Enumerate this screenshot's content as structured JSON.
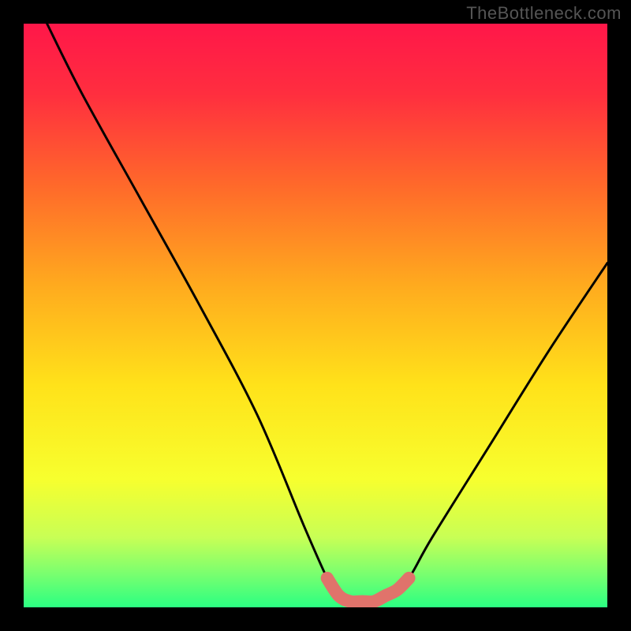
{
  "watermark": "TheBottleneck.com",
  "chart_data": {
    "type": "line",
    "title": "",
    "xlabel": "",
    "ylabel": "",
    "xlim": [
      0,
      100
    ],
    "ylim": [
      0,
      100
    ],
    "series": [
      {
        "name": "bottleneck-curve",
        "x": [
          4,
          10,
          20,
          30,
          40,
          48,
          52,
          54,
          57,
          60,
          63,
          66,
          70,
          80,
          90,
          100
        ],
        "y": [
          100,
          88,
          70,
          52,
          33,
          14,
          5,
          2,
          1,
          1,
          2,
          5,
          12,
          28,
          44,
          59
        ]
      },
      {
        "name": "flat-bottom-highlight",
        "x": [
          52,
          54,
          56,
          58,
          60,
          62,
          64,
          66
        ],
        "y": [
          5,
          2,
          1,
          1,
          1,
          2,
          3,
          5
        ]
      }
    ],
    "gradient_stops": [
      {
        "offset": 0.0,
        "color": "#ff1749"
      },
      {
        "offset": 0.12,
        "color": "#ff2e3f"
      },
      {
        "offset": 0.28,
        "color": "#ff6a2a"
      },
      {
        "offset": 0.45,
        "color": "#ffab1e"
      },
      {
        "offset": 0.62,
        "color": "#ffe21a"
      },
      {
        "offset": 0.78,
        "color": "#f7ff2e"
      },
      {
        "offset": 0.88,
        "color": "#c8ff55"
      },
      {
        "offset": 0.94,
        "color": "#7dff6e"
      },
      {
        "offset": 1.0,
        "color": "#2bff82"
      }
    ],
    "highlight_color": "#e0736b",
    "curve_color": "#000000"
  }
}
